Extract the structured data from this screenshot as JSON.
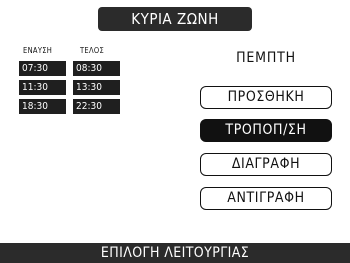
{
  "header": {
    "title": "ΚΥΡΙΑ ΖΩΝΗ"
  },
  "schedule": {
    "col_start_label": "ΕΝΑΥΣΗ",
    "col_end_label": "ΤΕΛΟΣ",
    "rows": [
      {
        "start": "07:30",
        "end": "08:30"
      },
      {
        "start": "11:30",
        "end": "13:30"
      },
      {
        "start": "18:30",
        "end": "22:30"
      }
    ]
  },
  "day_label": "ΠΕΜΠΤΗ",
  "actions": {
    "add": "ΠΡΟΣΘΗΚΗ",
    "edit": "ΤΡΟΠΟΠ/ΣΗ",
    "delete": "ΔΙΑΓΡΑΦΗ",
    "copy": "ΑΝΤΙΓΡΑΦΗ"
  },
  "footer": {
    "text": "ΕΠΙΛΟΓΗ ΛΕΙΤΟΥΡΓΙΑΣ"
  }
}
